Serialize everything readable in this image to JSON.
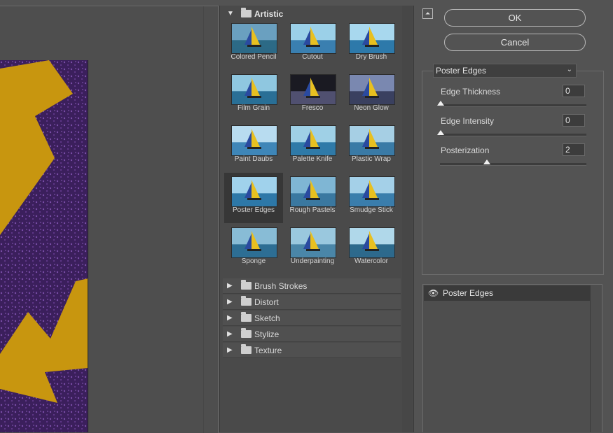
{
  "gallery": {
    "open_folder": "Artistic",
    "thumbnails": [
      {
        "label": "Colored Pencil"
      },
      {
        "label": "Cutout"
      },
      {
        "label": "Dry Brush"
      },
      {
        "label": "Film Grain"
      },
      {
        "label": "Fresco"
      },
      {
        "label": "Neon Glow"
      },
      {
        "label": "Paint Daubs"
      },
      {
        "label": "Palette Knife"
      },
      {
        "label": "Plastic Wrap"
      },
      {
        "label": "Poster Edges"
      },
      {
        "label": "Rough Pastels"
      },
      {
        "label": "Smudge Stick"
      },
      {
        "label": "Sponge"
      },
      {
        "label": "Underpainting"
      },
      {
        "label": "Watercolor"
      }
    ],
    "selected": "Poster Edges",
    "folders": [
      "Brush Strokes",
      "Distort",
      "Sketch",
      "Stylize",
      "Texture"
    ]
  },
  "buttons": {
    "ok": "OK",
    "cancel": "Cancel"
  },
  "settings": {
    "filter": "Poster Edges",
    "params": [
      {
        "label": "Edge Thickness",
        "value": "0",
        "fraction": 0.0
      },
      {
        "label": "Edge Intensity",
        "value": "0",
        "fraction": 0.0
      },
      {
        "label": "Posterization",
        "value": "2",
        "fraction": 0.33
      }
    ]
  },
  "layers": {
    "items": [
      {
        "name": "Poster Edges"
      }
    ]
  },
  "colors": {
    "preview_bg": "#3b1f5c",
    "preview_shape": "#c8960f"
  }
}
